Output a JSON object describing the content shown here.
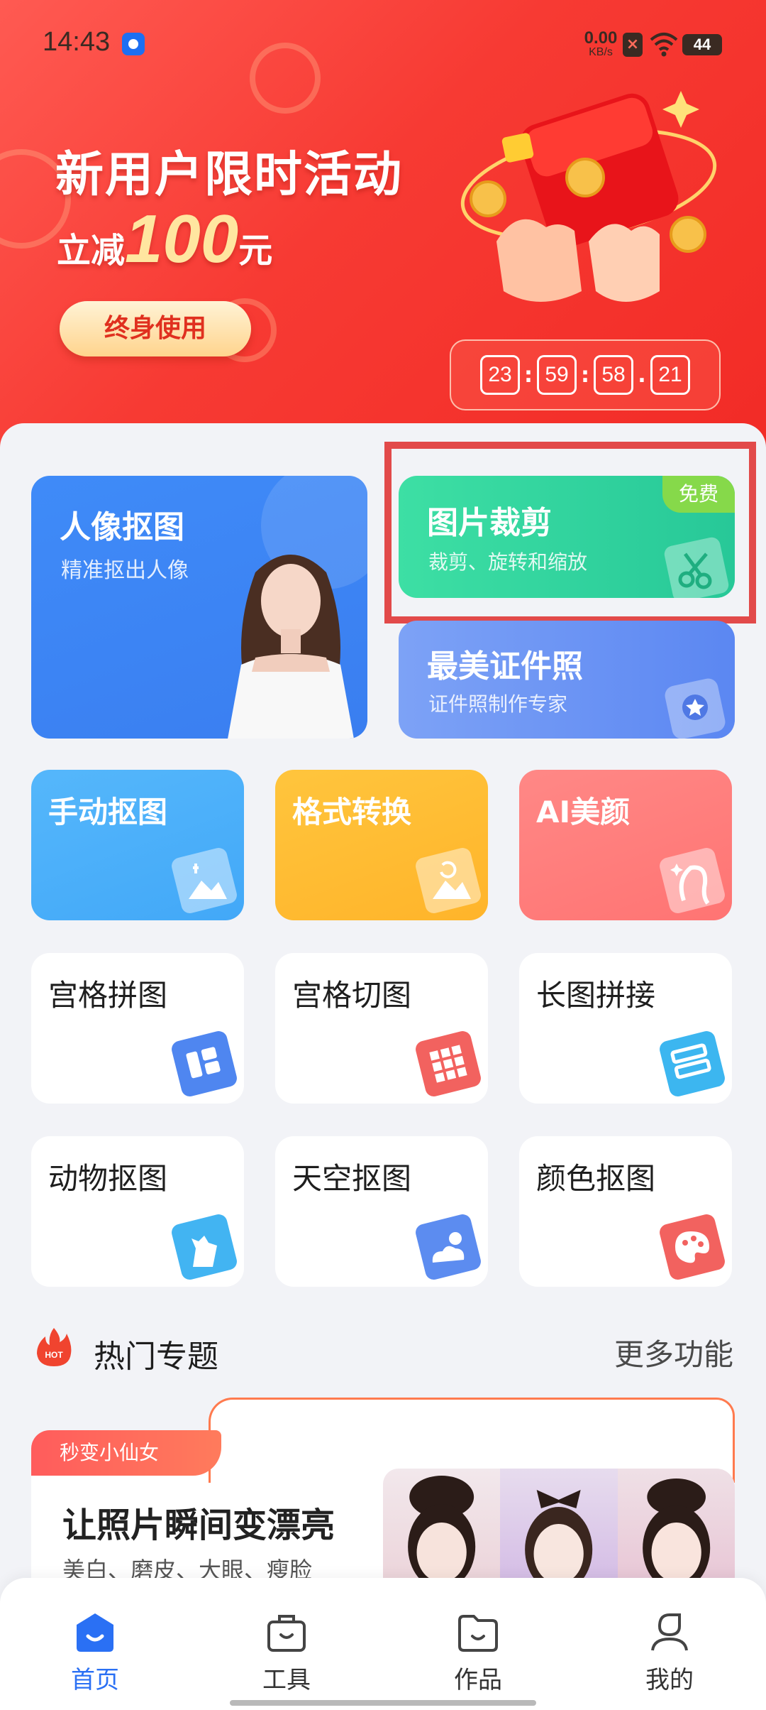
{
  "status_bar": {
    "time": "14:43",
    "net_speed_value": "0.00",
    "net_speed_unit": "KB/s",
    "battery": "44"
  },
  "banner": {
    "title": "新用户限时活动",
    "subtitle_prefix": "立减",
    "amount": "100",
    "unit": "元",
    "button_label": "终身使用",
    "countdown": [
      "23",
      "59",
      "58",
      "21"
    ]
  },
  "features": {
    "portrait_cutout": {
      "title": "人像抠图",
      "subtitle": "精准抠出人像"
    },
    "image_crop": {
      "title": "图片裁剪",
      "subtitle": "裁剪、旋转和缩放",
      "badge": "免费"
    },
    "id_photo": {
      "title": "最美证件照",
      "subtitle": "证件照制作专家"
    }
  },
  "tools": [
    {
      "label": "手动抠图",
      "icon": "manual-cutout-icon"
    },
    {
      "label": "格式转换",
      "icon": "format-convert-icon"
    },
    {
      "label": "AI美颜",
      "icon": "ai-beauty-icon"
    },
    {
      "label": "宫格拼图",
      "icon": "grid-collage-icon"
    },
    {
      "label": "宫格切图",
      "icon": "grid-split-icon"
    },
    {
      "label": "长图拼接",
      "icon": "long-stitch-icon"
    },
    {
      "label": "动物抠图",
      "icon": "animal-cutout-icon"
    },
    {
      "label": "天空抠图",
      "icon": "sky-cutout-icon"
    },
    {
      "label": "颜色抠图",
      "icon": "color-cutout-icon"
    }
  ],
  "hot": {
    "badge": "HOT",
    "title": "热门专题",
    "more": "更多功能"
  },
  "topic_card": {
    "tag": "秒变小仙女",
    "title": "让照片瞬间变漂亮",
    "subtitle": "美白、磨皮、大眼、瘦脸"
  },
  "bottom_nav": [
    {
      "label": "首页",
      "active": true
    },
    {
      "label": "工具",
      "active": false
    },
    {
      "label": "作品",
      "active": false
    },
    {
      "label": "我的",
      "active": false
    }
  ],
  "colors": {
    "accent": "#2A70F4",
    "banner_red": "#F73A33",
    "highlight_box": "#E24A4A",
    "crop_green": "#27C898",
    "free_badge": "#86D94A"
  }
}
